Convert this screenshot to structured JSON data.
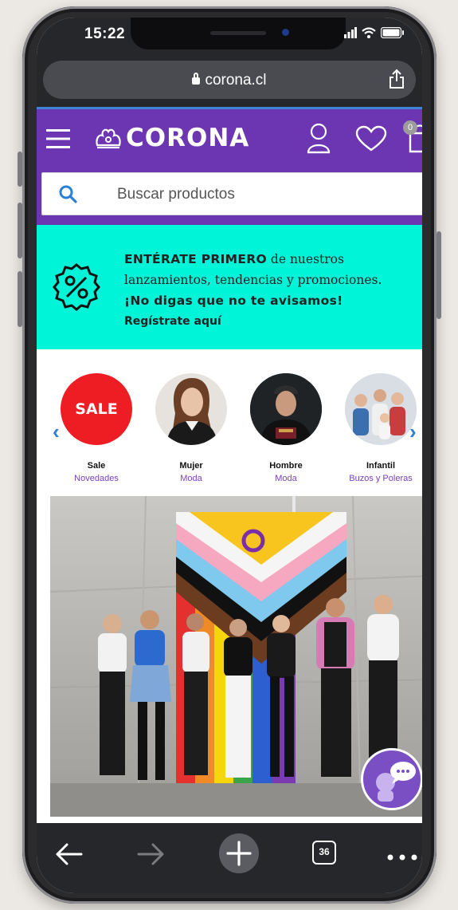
{
  "status": {
    "time": "15:22"
  },
  "browser": {
    "url": "corona.cl",
    "tab_count": "36"
  },
  "header": {
    "logo_text": "CORONA",
    "cart_count": "0"
  },
  "search": {
    "placeholder": "Buscar productos"
  },
  "promo": {
    "line1_bold": "ENTÉRATE PRIMERO",
    "line1_rest": " de nuestros",
    "line2": "lanzamientos, tendencias y promociones.",
    "line3": "¡No digas que no te avisamos!",
    "line4": "Regístrate aquí"
  },
  "categories": [
    {
      "title": "Sale",
      "subtitle": "Novedades",
      "badge": "SALE"
    },
    {
      "title": "Mujer",
      "subtitle": "Moda"
    },
    {
      "title": "Hombre",
      "subtitle": "Moda"
    },
    {
      "title": "Infantil",
      "subtitle": "Buzos y Poleras"
    }
  ],
  "colors": {
    "brand": "#6c35b2",
    "promo": "#00f5d8",
    "sale": "#ee1d23",
    "link": "#7a3fc1"
  }
}
